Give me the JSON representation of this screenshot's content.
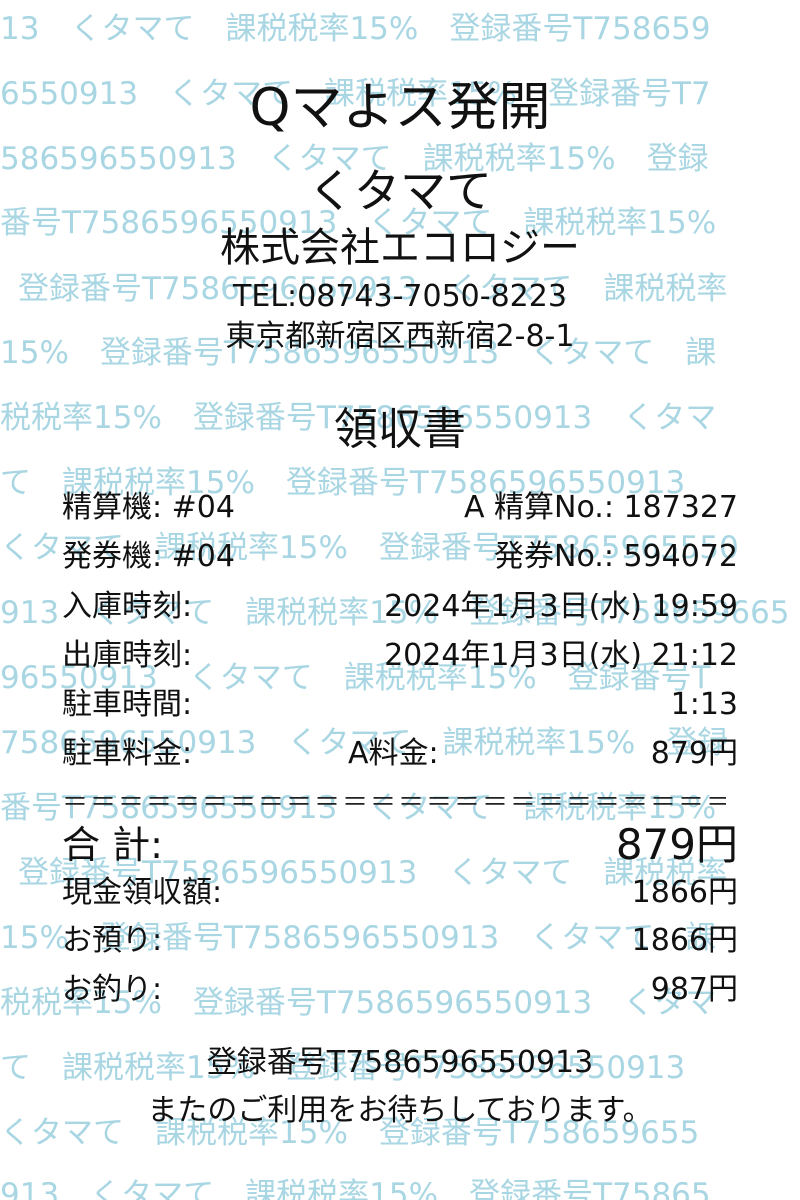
{
  "watermark": {
    "lines": [
      "13　くタマて　課税税率15%　登録番号T758659",
      "6550913　くタマて　課税税率15%　登録番号T7",
      "586596550913　くタマて　課税税率15%　登録",
      "番号T7586596550913　くタマて　課税税率15%",
      "登録番号T7586596550913　くタマて　課税税率",
      "15%　登録番号T7586596550913　くタマて　課",
      "税税率15%　登録番号T7586596550913　くタマ",
      "て　課税税率15%　登録番号T7586596550913",
      "くタマて　課税税率15%　登録番号T75865965550",
      "913　くタマて　課税税率15%　登録番号T758659665",
      "96550913　くタマて　課税税率15%　登録番号T",
      "7586596550913　くタマて　課税税率15%　登録",
      "番号T7586596550913　くタマて　課税税率15%",
      "登録番号T7586596550913　くタマて　課税税率",
      "15%　登録番号T7586596550913　くタマて　課",
      "税税率15%　登録番号T7586596550913　くタマ",
      "て　課税税率15%　登録番号T7586596550913",
      "くタマて　課税税率15%　登録番号T758659655",
      "913　くタマて　課税税率15%　登録番号T75865"
    ],
    "color": "#a9d6e3"
  },
  "header": {
    "store_name": "Qマよス発開",
    "brand": "くタマて",
    "company": "株式会社エコロジー",
    "tel": "TEL:08743-7050-8223",
    "address": "東京都新宿区西新宿2-8-1",
    "title": "領収書"
  },
  "details": {
    "machine_label": "精算機: #04",
    "machine_no": "A 精算No.: 187327",
    "ticket_label": "発券機: #04",
    "ticket_no": "発券No.: 594072",
    "entry_label": "入庫時刻:",
    "entry_value": "2024年1月3日(水) 19:59",
    "exit_label": "出庫時刻:",
    "exit_value": "2024年1月3日(水) 21:12",
    "duration_label": "駐車時間:",
    "duration_value": "1:13",
    "fee_label": "駐車料金:",
    "fee_type": "A料金:",
    "fee_value": "879円"
  },
  "divider": "＝＝＝＝＝＝＝＝＝＝＝＝＝＝＝＝＝＝＝＝＝＝＝＝＝＝＝＝",
  "totals": {
    "total_label": "合 計:",
    "total_value": "879円",
    "cash_label": "現金領収額:",
    "cash_value": "1866円",
    "deposit_label": "お預り:",
    "deposit_value": "1866円",
    "change_label": "お釣り:",
    "change_value": "987円"
  },
  "footer": {
    "registration": "登録番号T7586596550913",
    "thanks": "またのご利用をお待ちしております。"
  }
}
